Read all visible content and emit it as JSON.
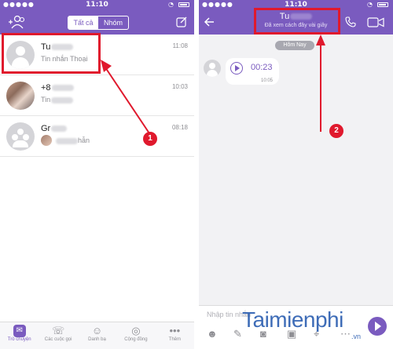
{
  "left": {
    "status": {
      "carrier": "",
      "time": "11:10"
    },
    "tabs": {
      "all": "Tất cả",
      "groups": "Nhóm"
    },
    "chats": [
      {
        "name": "Tu",
        "preview": "Tin nhắn Thoại",
        "time": "11:08"
      },
      {
        "name": "+8",
        "preview": "Tin",
        "time": "10:03"
      },
      {
        "name": "Gr",
        "preview": "hẫn",
        "time": "08:18"
      }
    ],
    "tabbar": [
      "Trò chuyện",
      "Các cuộc gọi",
      "Danh bạ",
      "Cộng đồng",
      "Thêm"
    ],
    "marker": "1"
  },
  "right": {
    "status": {
      "time": "11:10"
    },
    "contact": {
      "name": "Tu",
      "subtitle": "Đã xem cách đây vài giây"
    },
    "date_pill": "Hôm Nay",
    "voice_message": {
      "duration": "00:23",
      "time": "10:05"
    },
    "input_placeholder": "Nhập tin nhắn",
    "marker": "2"
  },
  "watermark": {
    "brand": "Taimienphi",
    "domain": ".vn"
  },
  "colors": {
    "accent": "#7a5bbf",
    "highlight": "#e0192d"
  }
}
